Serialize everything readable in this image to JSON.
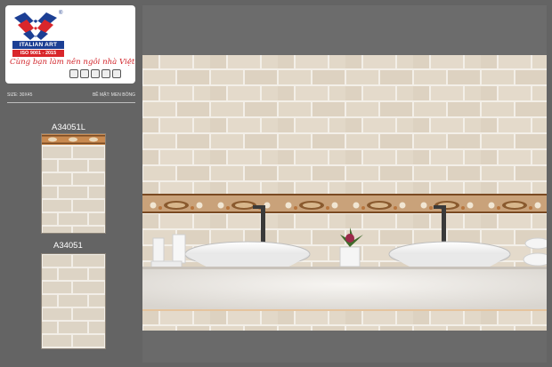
{
  "brand": {
    "logo_name": "ITALIAN ART",
    "registered_mark": "®",
    "iso": "ISO 9001 - 2015",
    "slogan": "Cùng bạn làm nên ngôi nhà Việt"
  },
  "specs": {
    "size_label": "SIZE: 30X45",
    "surface_label": "BỀ MẶT: MEN BÓNG"
  },
  "tiles": [
    {
      "code": "A34051L",
      "type": "border-tile"
    },
    {
      "code": "A34051",
      "type": "plain-tile"
    }
  ],
  "colors": {
    "background": "#646464",
    "brand_blue": "#1c3f94",
    "brand_red": "#d9262b",
    "tile_beige": "#e3dbce",
    "grout": "#f4f1ec",
    "border_brown": "#b8763e"
  }
}
